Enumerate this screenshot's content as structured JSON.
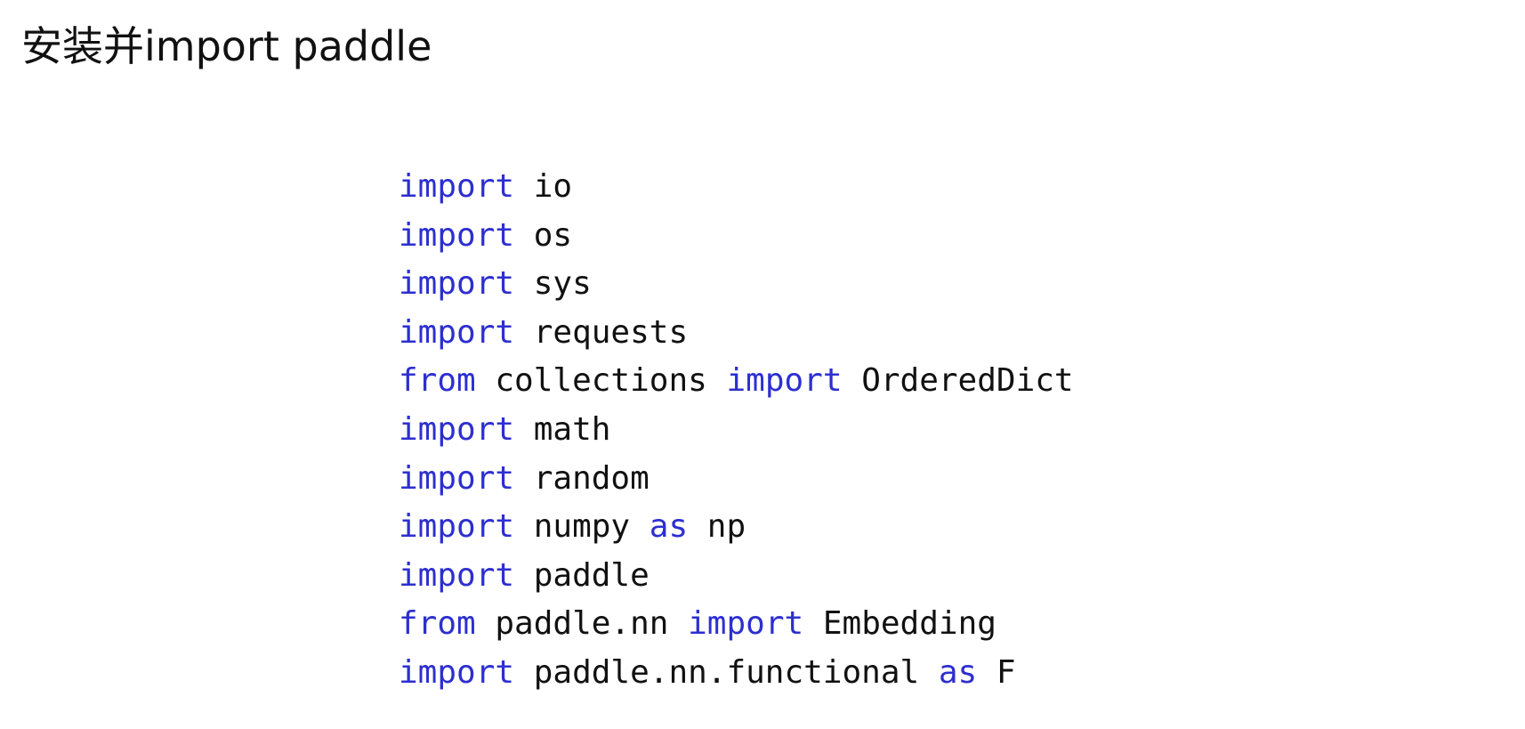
{
  "title": "安装并import paddle",
  "colors": {
    "keyword": "#2d2fd0",
    "text": "#111111",
    "background": "#ffffff"
  },
  "code_lines": [
    [
      {
        "t": "import",
        "k": true
      },
      {
        "t": " io",
        "k": false
      }
    ],
    [
      {
        "t": "import",
        "k": true
      },
      {
        "t": " os",
        "k": false
      }
    ],
    [
      {
        "t": "import",
        "k": true
      },
      {
        "t": " sys",
        "k": false
      }
    ],
    [
      {
        "t": "import",
        "k": true
      },
      {
        "t": " requests",
        "k": false
      }
    ],
    [
      {
        "t": "from",
        "k": true
      },
      {
        "t": " collections ",
        "k": false
      },
      {
        "t": "import",
        "k": true
      },
      {
        "t": " OrderedDict",
        "k": false
      }
    ],
    [
      {
        "t": "import",
        "k": true
      },
      {
        "t": " math",
        "k": false
      }
    ],
    [
      {
        "t": "import",
        "k": true
      },
      {
        "t": " random",
        "k": false
      }
    ],
    [
      {
        "t": "import",
        "k": true
      },
      {
        "t": " numpy ",
        "k": false
      },
      {
        "t": "as",
        "k": true
      },
      {
        "t": " np",
        "k": false
      }
    ],
    [
      {
        "t": "import",
        "k": true
      },
      {
        "t": " paddle",
        "k": false
      }
    ],
    [
      {
        "t": "from",
        "k": true
      },
      {
        "t": " paddle.nn ",
        "k": false
      },
      {
        "t": "import",
        "k": true
      },
      {
        "t": " Embedding",
        "k": false
      }
    ],
    [
      {
        "t": "import",
        "k": true
      },
      {
        "t": " paddle.nn.functional ",
        "k": false
      },
      {
        "t": "as",
        "k": true
      },
      {
        "t": " F",
        "k": false
      }
    ]
  ]
}
